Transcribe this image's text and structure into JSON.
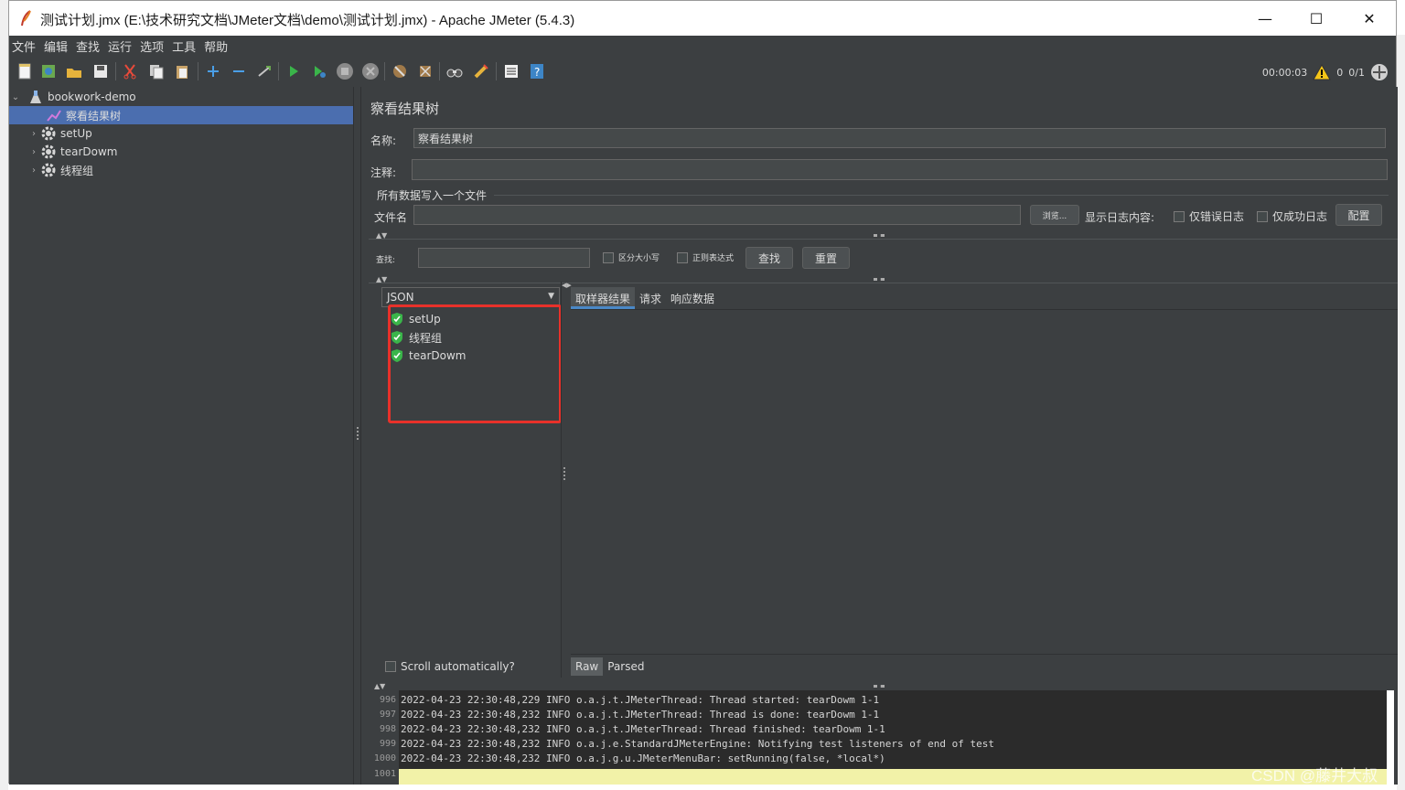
{
  "window": {
    "title": "测试计划.jmx (E:\\技术研究文档\\JMeter文档\\demo\\测试计划.jmx) - Apache JMeter (5.4.3)",
    "minimize": "—",
    "maximize": "☐",
    "close": "✕"
  },
  "menu": [
    "文件",
    "编辑",
    "查找",
    "运行",
    "选项",
    "工具",
    "帮助"
  ],
  "status": {
    "elapsed": "00:00:03",
    "warnings": "0",
    "threads": "0/1"
  },
  "tree": {
    "root": "bookwork-demo",
    "items": [
      "察看结果树",
      "setUp",
      "tearDowm",
      "线程组"
    ]
  },
  "panel": {
    "heading": "察看结果树",
    "name_label": "名称:",
    "name_value": "察看结果树",
    "comment_label": "注释:",
    "comment_value": "",
    "file_section": "所有数据写入一个文件",
    "filename_label": "文件名",
    "browse_button": "浏览...",
    "log_display_label": "显示日志内容:",
    "errors_only": "仅错误日志",
    "success_only": "仅成功日志",
    "configure_button": "配置",
    "search_label": "查找:",
    "case_sensitive": "区分大小写",
    "regex": "正则表达式",
    "search_button": "查找",
    "reset_button": "重置",
    "renderer": "JSON",
    "results": [
      "setUp",
      "线程组",
      "tearDowm"
    ],
    "scroll_auto": "Scroll automatically?",
    "tabs": [
      "取样器结果",
      "请求",
      "响应数据"
    ],
    "detail_tabs": [
      "Raw",
      "Parsed"
    ]
  },
  "log": {
    "lines": [
      {
        "num": "996",
        "text": "2022-04-23 22:30:48,229 INFO o.a.j.t.JMeterThread: Thread started: tearDowm 1-1"
      },
      {
        "num": "997",
        "text": "2022-04-23 22:30:48,232 INFO o.a.j.t.JMeterThread: Thread is done: tearDowm 1-1"
      },
      {
        "num": "998",
        "text": "2022-04-23 22:30:48,232 INFO o.a.j.t.JMeterThread: Thread finished: tearDowm 1-1"
      },
      {
        "num": "999",
        "text": "2022-04-23 22:30:48,232 INFO o.a.j.e.StandardJMeterEngine: Notifying test listeners of end of test"
      },
      {
        "num": "1000",
        "text": "2022-04-23 22:30:48,232 INFO o.a.j.g.u.JMeterMenuBar: setRunning(false, *local*)"
      },
      {
        "num": "1001",
        "text": ""
      }
    ]
  },
  "watermark": "CSDN @藤井大叔",
  "colors": {
    "background": "#3c3f41",
    "selection": "#4b6eaf",
    "highlight": "#e8312a",
    "success": "#3ab54a"
  }
}
